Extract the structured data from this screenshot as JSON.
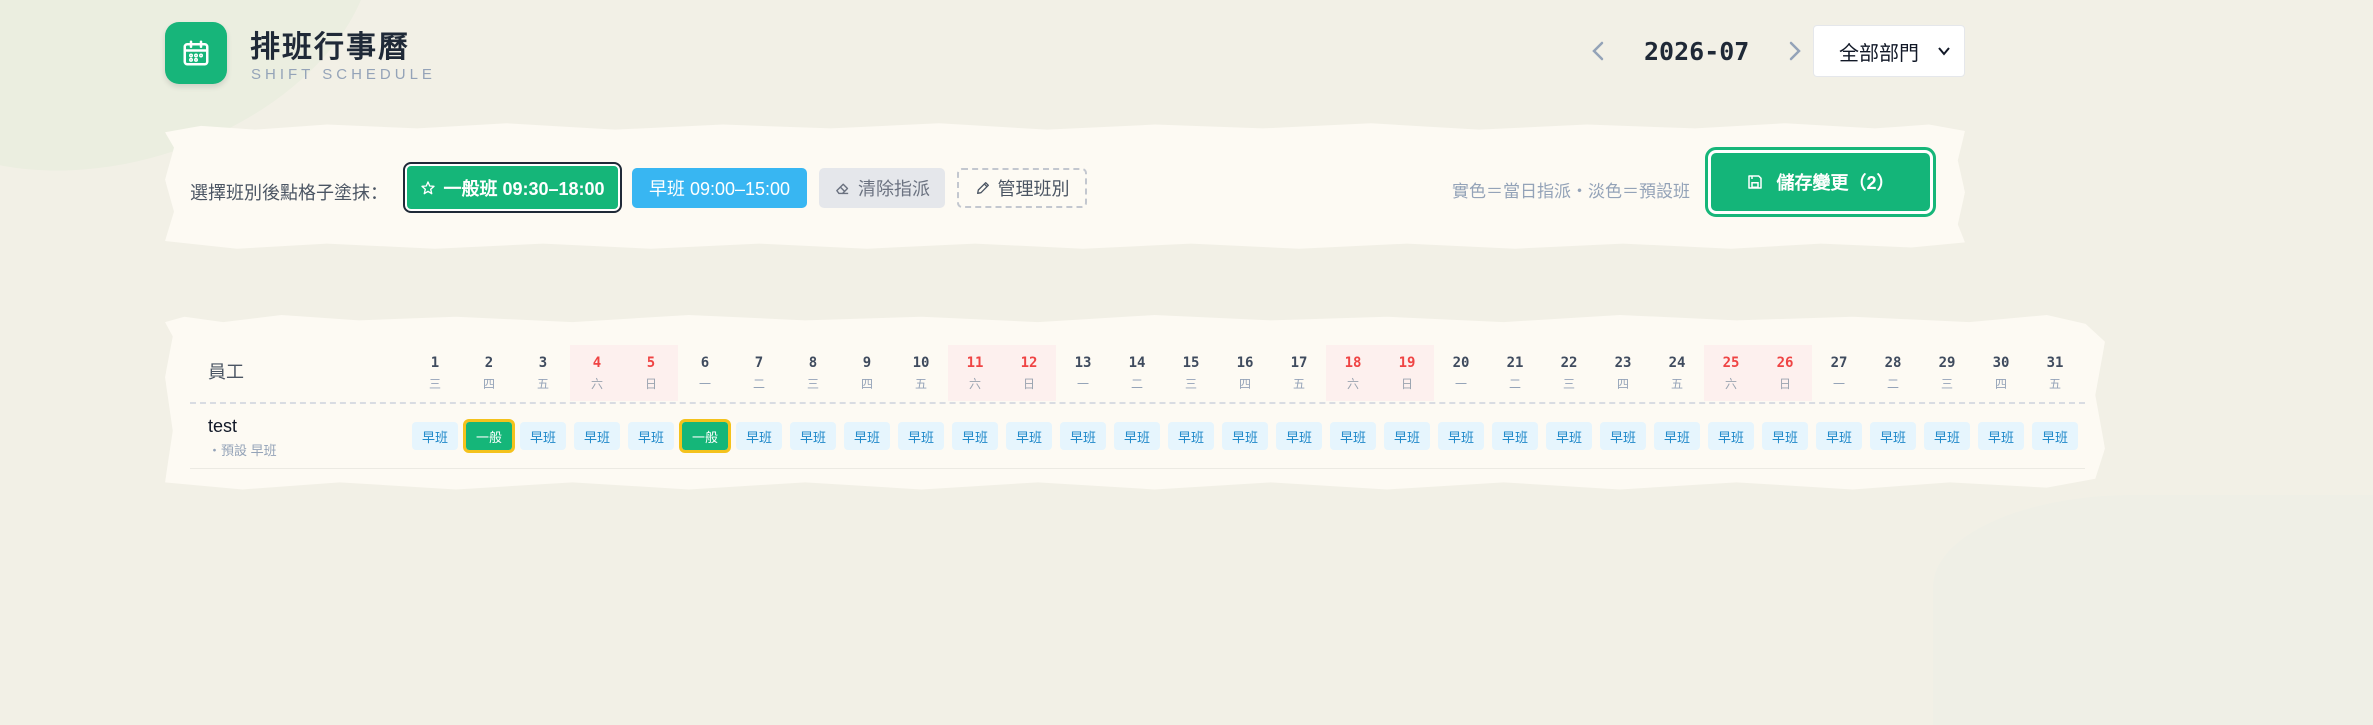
{
  "header": {
    "title": "排班行事曆",
    "subtitle": "SHIFT SCHEDULE",
    "month": "2026-07",
    "department": "全部部門"
  },
  "toolbar": {
    "instruction": "選擇班別後點格子塗抹：",
    "shift_normal": "一般班 09:30–18:00",
    "shift_early": "早班 09:00–15:00",
    "clear": "清除指派",
    "manage": "管理班別",
    "legend": "實色＝當日指派・淡色＝預設班",
    "save": "儲存變更（2）"
  },
  "colors": {
    "accent": "#15b679",
    "early": "#38b6f2",
    "weekend": "#ef4444",
    "highlight": "#f4c21c"
  },
  "grid": {
    "employee_header": "員工",
    "days": [
      {
        "d": "1",
        "w": "三",
        "weekend": false
      },
      {
        "d": "2",
        "w": "四",
        "weekend": false
      },
      {
        "d": "3",
        "w": "五",
        "weekend": false
      },
      {
        "d": "4",
        "w": "六",
        "weekend": true
      },
      {
        "d": "5",
        "w": "日",
        "weekend": true
      },
      {
        "d": "6",
        "w": "一",
        "weekend": false
      },
      {
        "d": "7",
        "w": "二",
        "weekend": false
      },
      {
        "d": "8",
        "w": "三",
        "weekend": false
      },
      {
        "d": "9",
        "w": "四",
        "weekend": false
      },
      {
        "d": "10",
        "w": "五",
        "weekend": false
      },
      {
        "d": "11",
        "w": "六",
        "weekend": true
      },
      {
        "d": "12",
        "w": "日",
        "weekend": true
      },
      {
        "d": "13",
        "w": "一",
        "weekend": false
      },
      {
        "d": "14",
        "w": "二",
        "weekend": false
      },
      {
        "d": "15",
        "w": "三",
        "weekend": false
      },
      {
        "d": "16",
        "w": "四",
        "weekend": false
      },
      {
        "d": "17",
        "w": "五",
        "weekend": false
      },
      {
        "d": "18",
        "w": "六",
        "weekend": true
      },
      {
        "d": "19",
        "w": "日",
        "weekend": true
      },
      {
        "d": "20",
        "w": "一",
        "weekend": false
      },
      {
        "d": "21",
        "w": "二",
        "weekend": false
      },
      {
        "d": "22",
        "w": "三",
        "weekend": false
      },
      {
        "d": "23",
        "w": "四",
        "weekend": false
      },
      {
        "d": "24",
        "w": "五",
        "weekend": false
      },
      {
        "d": "25",
        "w": "六",
        "weekend": true
      },
      {
        "d": "26",
        "w": "日",
        "weekend": true
      },
      {
        "d": "27",
        "w": "一",
        "weekend": false
      },
      {
        "d": "28",
        "w": "二",
        "weekend": false
      },
      {
        "d": "29",
        "w": "三",
        "weekend": false
      },
      {
        "d": "30",
        "w": "四",
        "weekend": false
      },
      {
        "d": "31",
        "w": "五",
        "weekend": false
      }
    ],
    "employees": [
      {
        "name": "test",
        "default_label": "・預設  早班",
        "shifts": [
          {
            "label": "早班",
            "type": "early"
          },
          {
            "label": "一般",
            "type": "normal"
          },
          {
            "label": "早班",
            "type": "early"
          },
          {
            "label": "早班",
            "type": "early"
          },
          {
            "label": "早班",
            "type": "early"
          },
          {
            "label": "一般",
            "type": "normal"
          },
          {
            "label": "早班",
            "type": "early"
          },
          {
            "label": "早班",
            "type": "early"
          },
          {
            "label": "早班",
            "type": "early"
          },
          {
            "label": "早班",
            "type": "early"
          },
          {
            "label": "早班",
            "type": "early"
          },
          {
            "label": "早班",
            "type": "early"
          },
          {
            "label": "早班",
            "type": "early"
          },
          {
            "label": "早班",
            "type": "early"
          },
          {
            "label": "早班",
            "type": "early"
          },
          {
            "label": "早班",
            "type": "early"
          },
          {
            "label": "早班",
            "type": "early"
          },
          {
            "label": "早班",
            "type": "early"
          },
          {
            "label": "早班",
            "type": "early"
          },
          {
            "label": "早班",
            "type": "early"
          },
          {
            "label": "早班",
            "type": "early"
          },
          {
            "label": "早班",
            "type": "early"
          },
          {
            "label": "早班",
            "type": "early"
          },
          {
            "label": "早班",
            "type": "early"
          },
          {
            "label": "早班",
            "type": "early"
          },
          {
            "label": "早班",
            "type": "early"
          },
          {
            "label": "早班",
            "type": "early"
          },
          {
            "label": "早班",
            "type": "early"
          },
          {
            "label": "早班",
            "type": "early"
          },
          {
            "label": "早班",
            "type": "early"
          },
          {
            "label": "早班",
            "type": "early"
          }
        ]
      }
    ]
  }
}
